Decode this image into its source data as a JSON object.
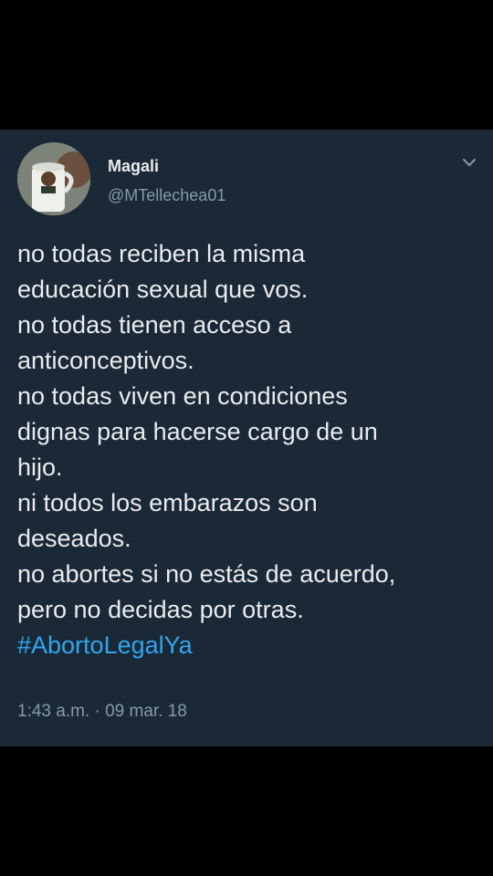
{
  "tweet": {
    "display_name": "Magali",
    "handle": "@MTellechea01",
    "lines": [
      "no todas reciben la misma",
      "educación sexual que vos.",
      "no todas tienen acceso a",
      "anticonceptivos.",
      "no todas viven en condiciones",
      "dignas para hacerse cargo de un",
      "hijo.",
      "ni todos los embarazos son",
      "deseados.",
      "no abortes si no estás de acuerdo,",
      "pero no decidas por otras."
    ],
    "hashtag": "#AbortoLegalYa",
    "timestamp": "1:43 a.m. · 09 mar. 18"
  },
  "icons": {
    "more_options": "chevron-down-icon",
    "avatar": "avatar-photo"
  },
  "colors": {
    "page_background": "#000000",
    "card_background": "#1b2836",
    "text_primary": "#e9ecee",
    "text_secondary": "#8899a6",
    "hashtag": "#2da7f0"
  }
}
